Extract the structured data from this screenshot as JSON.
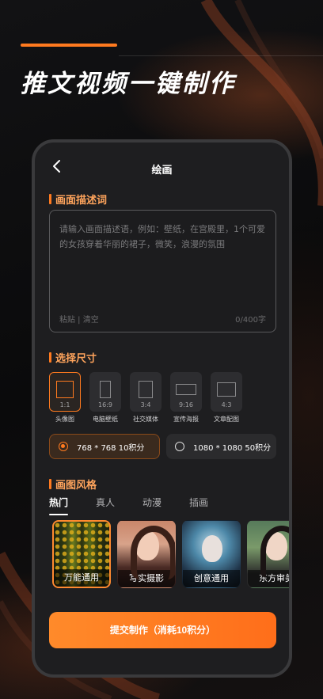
{
  "hero": {
    "title": "推文视频一键制作"
  },
  "nav": {
    "title": "绘画"
  },
  "description": {
    "section_label": "画面描述词",
    "placeholder": "请输入画面描述语，例如：壁纸，在宫殿里，1个可爱的女孩穿着华丽的裙子，微笑，浪漫的氛围",
    "actions": "粘贴 | 清空",
    "counter": "0/400字"
  },
  "size": {
    "section_label": "选择尺寸",
    "options": [
      {
        "ratio": "1:1",
        "label": "头像图"
      },
      {
        "ratio": "16:9",
        "label": "电脑壁纸"
      },
      {
        "ratio": "3:4",
        "label": "社交媒体"
      },
      {
        "ratio": "9:16",
        "label": "宣传海报"
      },
      {
        "ratio": "4:3",
        "label": "文章配图"
      }
    ],
    "resolutions": [
      {
        "label": "768 * 768 10积分"
      },
      {
        "label": "1080 * 1080 50积分"
      }
    ]
  },
  "style": {
    "section_label": "画图风格",
    "tabs": [
      "热门",
      "真人",
      "动漫",
      "插画"
    ],
    "cards": [
      {
        "label": "万能通用"
      },
      {
        "label": "写实摄影"
      },
      {
        "label": "创意通用"
      },
      {
        "label": "东方审美"
      }
    ]
  },
  "submit": {
    "label": "提交制作（消耗10积分）"
  },
  "colors": {
    "accent": "#ff7a1f",
    "panel": "#1e1e20",
    "background": "#0b0b0d"
  }
}
